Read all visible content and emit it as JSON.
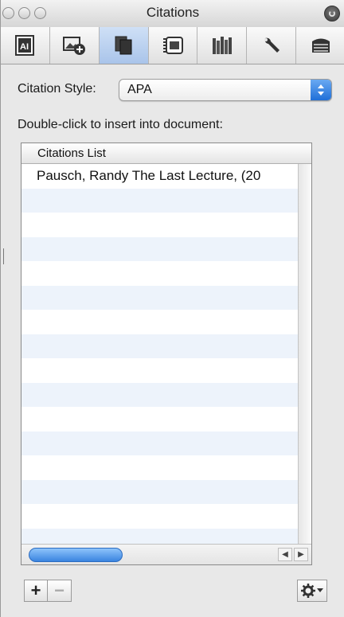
{
  "window": {
    "title": "Citations"
  },
  "toolbar": {
    "tabs": [
      {
        "icon": "text-box-icon",
        "active": false
      },
      {
        "icon": "add-image-icon",
        "active": false
      },
      {
        "icon": "copy-documents-icon",
        "active": true
      },
      {
        "icon": "media-browser-icon",
        "active": false
      },
      {
        "icon": "library-books-icon",
        "active": false
      },
      {
        "icon": "wrench-icon",
        "active": false
      },
      {
        "icon": "stack-drawer-icon",
        "active": false
      }
    ]
  },
  "citation_style": {
    "label": "Citation Style:",
    "value": "APA"
  },
  "instructions": "Double-click to insert into document:",
  "citations_list": {
    "header": "Citations List",
    "items": [
      "Pausch, Randy The Last Lecture, (20"
    ]
  },
  "buttons": {
    "add": "+",
    "remove": "−"
  },
  "colors": {
    "accent": "#3a84e0",
    "stripe": "#edf3fb",
    "active_tab": "#a9c4ea"
  }
}
